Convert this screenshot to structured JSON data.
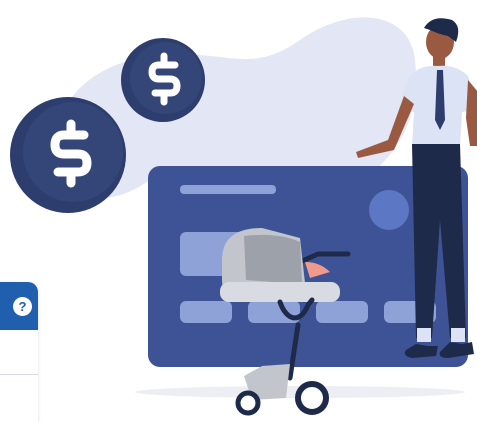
{
  "illustration": {
    "subject": "shopping-cart-credit-card",
    "colors": {
      "blob": "#e3e6f4",
      "card": "#3d5396",
      "card_stripe": "#8ea2d7",
      "coin": "#2c3d6e",
      "coin_symbol": "#ffffff",
      "cart": "#b4b7bf",
      "person_shirt": "#dce3f4",
      "person_pants": "#1e2a4a",
      "person_skin": "#9a5a42"
    }
  },
  "help_widget": {
    "icon": "question-icon",
    "label": "?",
    "accent": "#1f5fae"
  }
}
